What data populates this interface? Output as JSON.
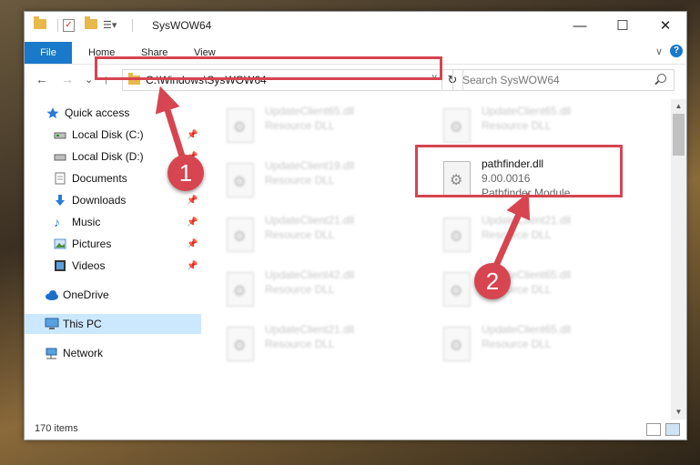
{
  "window": {
    "title": "SysWOW64",
    "minimize": "—",
    "maximize": "☐",
    "close": "✕"
  },
  "ribbon": {
    "tabs": [
      "File",
      "Home",
      "Share",
      "View"
    ],
    "help": "?",
    "collapse": "∨"
  },
  "nav": {
    "back": "←",
    "forward": "→",
    "recent": "⌄",
    "up": "↑",
    "address": "C:\\Windows\\SysWOW64",
    "address_dropdown": "∨",
    "refresh": "↻",
    "search_placeholder": "Search SysWOW64"
  },
  "sidebar": {
    "items": [
      {
        "label": "Quick access",
        "icon": "star-icon"
      },
      {
        "label": "Local Disk (C:)",
        "icon": "drive-icon",
        "pinned": true
      },
      {
        "label": "Local Disk (D:)",
        "icon": "drive-icon",
        "pinned": true
      },
      {
        "label": "Documents",
        "icon": "documents-icon",
        "pinned": true
      },
      {
        "label": "Downloads",
        "icon": "download-icon",
        "pinned": true
      },
      {
        "label": "Music",
        "icon": "music-icon",
        "pinned": true
      },
      {
        "label": "Pictures",
        "icon": "pictures-icon",
        "pinned": true
      },
      {
        "label": "Videos",
        "icon": "videos-icon",
        "pinned": true
      },
      {
        "label": "OneDrive",
        "icon": "cloud-icon"
      },
      {
        "label": "This PC",
        "icon": "computer-icon",
        "selected": true
      },
      {
        "label": "Network",
        "icon": "network-icon"
      }
    ],
    "pin_glyph": "📌"
  },
  "files": {
    "col1": [
      {
        "name": "UpdateClient65.dll",
        "desc": "Resource DLL"
      },
      {
        "name": "UpdateClient19.dll",
        "desc": "Resource DLL"
      },
      {
        "name": "UpdateClient21.dll",
        "desc": "Resource DLL"
      },
      {
        "name": "UpdateClient42.dll",
        "desc": "Resource DLL"
      },
      {
        "name": "UpdateClient21.dll",
        "desc": "Resource DLL"
      }
    ],
    "col2": [
      {
        "name": "UpdateClient65.dll",
        "desc": "Resource DLL"
      },
      {
        "name": "UpdateClient21.dll",
        "desc": "Resource DLL"
      },
      {
        "name": "UpdateClient65.dll",
        "desc": "Resource DLL"
      },
      {
        "name": "UpdateClient65.dll",
        "desc": "Resource DLL"
      }
    ],
    "highlighted": {
      "name": "pathfinder.dll",
      "version": "9.00.0016",
      "description": "Pathfinder Module"
    }
  },
  "status": {
    "item_count": "170 items"
  },
  "annotations": {
    "step1": "1",
    "step2": "2",
    "color": "#d64550"
  }
}
